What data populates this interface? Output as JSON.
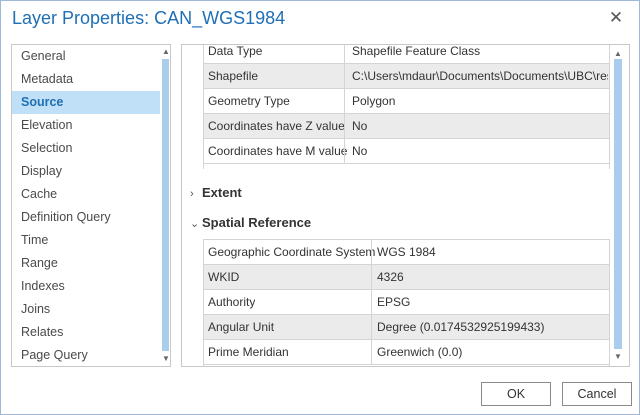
{
  "window": {
    "title": "Layer Properties: CAN_WGS1984"
  },
  "nav": {
    "items": [
      {
        "label": "General"
      },
      {
        "label": "Metadata"
      },
      {
        "label": "Source",
        "selected": true
      },
      {
        "label": "Elevation"
      },
      {
        "label": "Selection"
      },
      {
        "label": "Display"
      },
      {
        "label": "Cache"
      },
      {
        "label": "Definition Query"
      },
      {
        "label": "Time"
      },
      {
        "label": "Range"
      },
      {
        "label": "Indexes"
      },
      {
        "label": "Joins"
      },
      {
        "label": "Relates"
      },
      {
        "label": "Page Query"
      }
    ]
  },
  "source": {
    "top_rows": [
      {
        "key": "Data Type",
        "value": "Shapefile Feature Class"
      },
      {
        "key": "Shapefile",
        "value": "C:\\Users\\mdaur\\Documents\\Documents\\UBC\\rese"
      },
      {
        "key": "Geometry Type",
        "value": "Polygon"
      },
      {
        "key": "Coordinates have Z value",
        "value": "No"
      },
      {
        "key": "Coordinates have M value",
        "value": "No"
      }
    ],
    "extent_label": "Extent",
    "spatial_label": "Spatial Reference",
    "spatial_rows": [
      {
        "key": "Geographic Coordinate System",
        "value": "WGS 1984"
      },
      {
        "key": "WKID",
        "value": "4326"
      },
      {
        "key": "Authority",
        "value": "EPSG"
      },
      {
        "key": "Angular Unit",
        "value": "Degree (0.0174532925199433)"
      },
      {
        "key": "Prime Meridian",
        "value": "Greenwich (0.0)"
      }
    ]
  },
  "buttons": {
    "ok": "OK",
    "cancel": "Cancel"
  },
  "icons": {
    "close": "close-icon",
    "collapsed": "chevron-right-icon",
    "expanded": "chevron-down-icon"
  }
}
